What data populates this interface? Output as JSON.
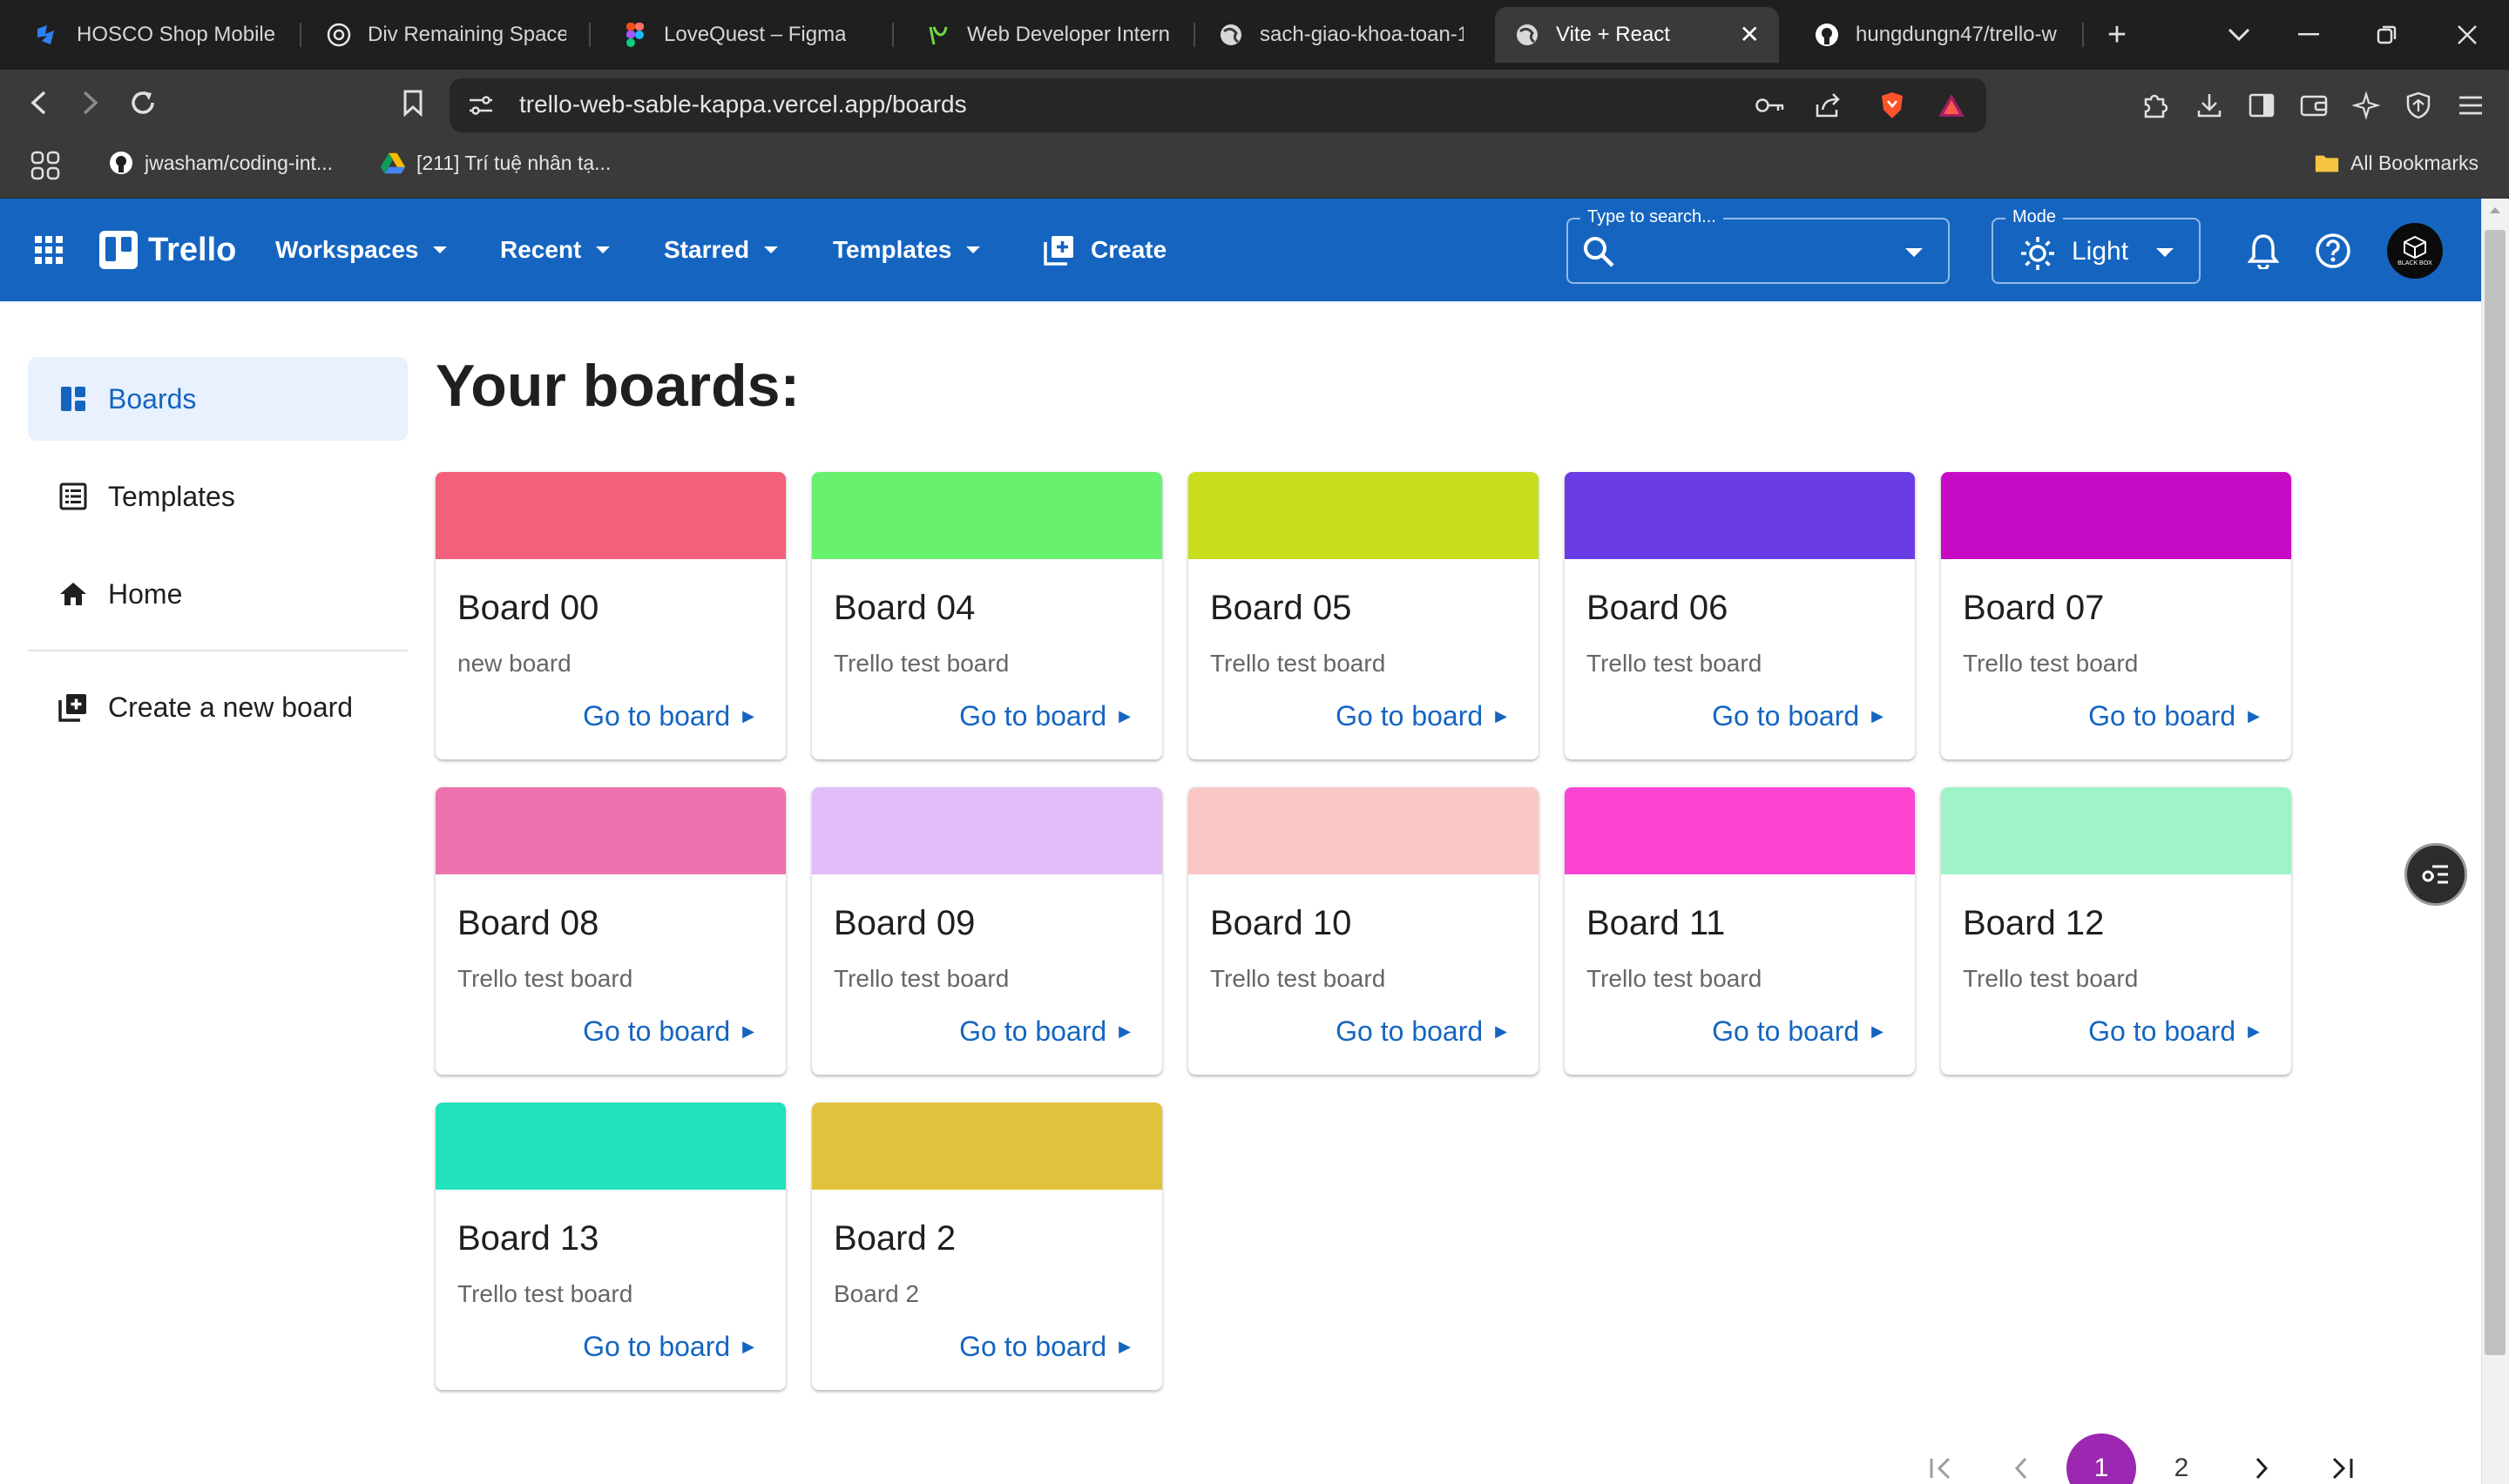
{
  "browser": {
    "tabs": [
      {
        "label": "HOSCO Shop Mobile -",
        "icon": "hosco-icon",
        "active": false
      },
      {
        "label": "Div Remaining Space T",
        "icon": "chatgpt-icon",
        "active": false
      },
      {
        "label": "LoveQuest – Figma",
        "icon": "figma-icon",
        "active": false
      },
      {
        "label": "Web Developer Intern (",
        "icon": "upwork-icon",
        "active": false
      },
      {
        "label": "sach-giao-khoa-toan-1",
        "icon": "globe-icon",
        "active": false
      },
      {
        "label": "Vite + React",
        "icon": "globe-icon",
        "active": true
      },
      {
        "label": "hungdungn47/trello-w",
        "icon": "github-icon",
        "active": false
      }
    ],
    "new_tab": "+",
    "tab_close": "✕",
    "url": "trello-web-sable-kappa.vercel.app/boards",
    "bookmarks": [
      {
        "label": "jwasham/coding-int...",
        "icon": "github-icon"
      },
      {
        "label": "[211] Trí tuệ nhân tạ...",
        "icon": "google-drive-icon"
      }
    ],
    "all_bookmarks": "All Bookmarks"
  },
  "appbar": {
    "logo": "Trello",
    "menus": [
      {
        "label": "Workspaces"
      },
      {
        "label": "Recent"
      },
      {
        "label": "Starred"
      },
      {
        "label": "Templates"
      }
    ],
    "create_label": "Create",
    "search": {
      "legend": "Type to search...",
      "value": ""
    },
    "mode": {
      "legend": "Mode",
      "value": "Light"
    },
    "avatar_text": "BLACK BOX"
  },
  "sidebar": {
    "items": [
      {
        "label": "Boards",
        "icon": "dashboard-icon",
        "active": true
      },
      {
        "label": "Templates",
        "icon": "list-alt-icon",
        "active": false
      },
      {
        "label": "Home",
        "icon": "home-icon",
        "active": false
      }
    ],
    "create_label": "Create a new board"
  },
  "main": {
    "title": "Your boards:",
    "link_label": "Go to board",
    "boards": [
      {
        "title": "Board 00",
        "description": "new board",
        "color": "#f2607b"
      },
      {
        "title": "Board 04",
        "description": "Trello test board",
        "color": "#68f06f"
      },
      {
        "title": "Board 05",
        "description": "Trello test board",
        "color": "#c8de1e"
      },
      {
        "title": "Board 06",
        "description": "Trello test board",
        "color": "#6a3ce6"
      },
      {
        "title": "Board 07",
        "description": "Trello test board",
        "color": "#c70bc4"
      },
      {
        "title": "Board 08",
        "description": "Trello test board",
        "color": "#ee72ad"
      },
      {
        "title": "Board 09",
        "description": "Trello test board",
        "color": "#e3bdf9"
      },
      {
        "title": "Board 10",
        "description": "Trello test board",
        "color": "#f9c8c5"
      },
      {
        "title": "Board 11",
        "description": "Trello test board",
        "color": "#fc45d3"
      },
      {
        "title": "Board 12",
        "description": "Trello test board",
        "color": "#9ef3c7"
      },
      {
        "title": "Board 13",
        "description": "Trello test board",
        "color": "#22e1bd"
      },
      {
        "title": "Board 2",
        "description": "Board 2",
        "color": "#e1c23c"
      }
    ]
  },
  "pagination": {
    "pages": [
      "1",
      "2"
    ],
    "current": "1"
  },
  "colors": {
    "primary": "#1565c0",
    "pagination_active": "#9c27b0",
    "sidebar_active_bg": "#e8f1fd"
  }
}
